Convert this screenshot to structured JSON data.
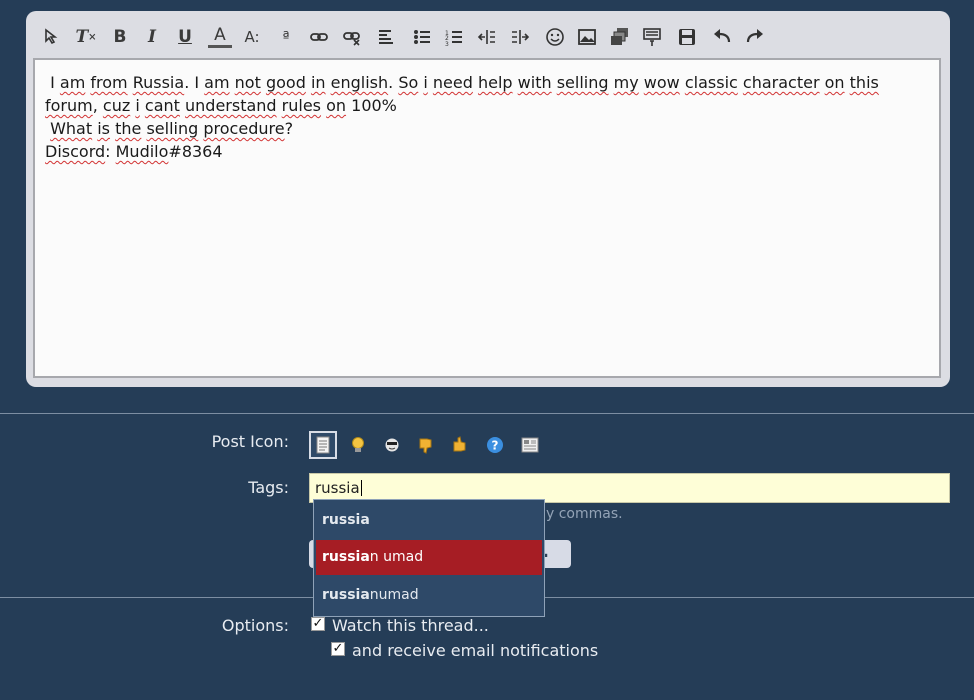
{
  "toolbar": {
    "buttons": [
      {
        "name": "switch-editor-mode",
        "glyph": "⟳"
      },
      {
        "name": "remove-formatting",
        "glyph": "Tx"
      },
      {
        "name": "bold",
        "glyph": "B"
      },
      {
        "name": "italic",
        "glyph": "I"
      },
      {
        "name": "underline",
        "glyph": "U"
      },
      {
        "name": "font-color",
        "glyph": "A"
      },
      {
        "name": "font-size",
        "glyph": "A:"
      },
      {
        "name": "font-family",
        "glyph": "a"
      },
      {
        "name": "insert-link",
        "glyph": "⚭"
      },
      {
        "name": "unlink",
        "glyph": "⚭"
      },
      {
        "name": "align",
        "glyph": "≡"
      },
      {
        "name": "bullet-list",
        "glyph": "•"
      },
      {
        "name": "numbered-list",
        "glyph": "1"
      },
      {
        "name": "outdent",
        "glyph": "⇤"
      },
      {
        "name": "indent",
        "glyph": "⇥"
      },
      {
        "name": "smilies",
        "glyph": "☺"
      },
      {
        "name": "insert-image",
        "glyph": "▣"
      },
      {
        "name": "insert-media",
        "glyph": "▤"
      },
      {
        "name": "more-options",
        "glyph": "▦"
      },
      {
        "name": "save-draft",
        "glyph": "💾"
      },
      {
        "name": "undo",
        "glyph": "↶"
      },
      {
        "name": "redo",
        "glyph": "↷"
      }
    ]
  },
  "editor": {
    "lines": [
      " I am from Russia. I am not good in english. So i need help with selling my wow classic character on this",
      "forum, cuz i cant understand rules on 100%",
      " What is the selling procedure?",
      "Discord: Mudilo#8364"
    ]
  },
  "form": {
    "post_icon_label": "Post Icon:",
    "tags_label": "Tags:",
    "tags_value": "russia",
    "tags_hint": "y commas.",
    "button_fragment": ".",
    "options_label": "Options:",
    "watch_label": "Watch this thread...",
    "email_label": "and receive email notifications",
    "post_icons": [
      "page-icon",
      "lightbulb-icon",
      "cool-icon",
      "thumbs-down-icon",
      "thumbs-up-icon",
      "question-icon",
      "article-icon"
    ]
  },
  "autocomplete": {
    "query": "russia",
    "items": [
      {
        "match": "russia",
        "rest": ""
      },
      {
        "match": "russia",
        "rest": "n umad"
      },
      {
        "match": "russia",
        "rest": "numad"
      }
    ],
    "active_index": 1
  },
  "colors": {
    "page_bg": "#253d57",
    "active_item": "#a61d24",
    "tag_input_bg": "#fefed7"
  }
}
